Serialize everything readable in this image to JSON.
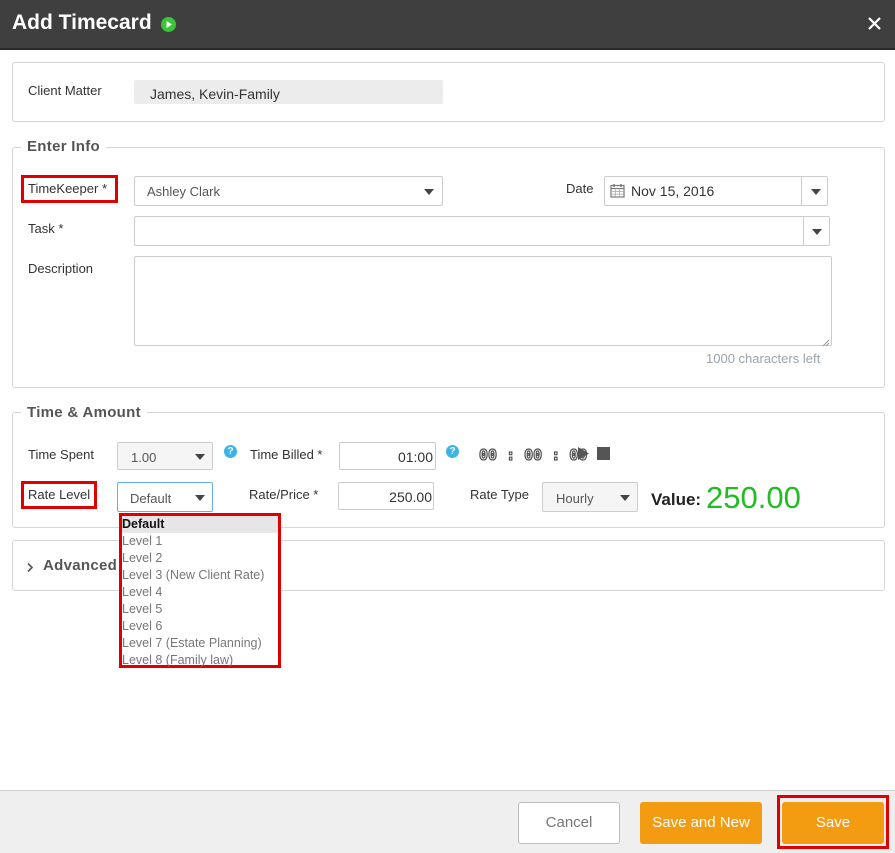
{
  "header": {
    "title": "Add Timecard"
  },
  "client_matter": {
    "label": "Client Matter",
    "value": "James, Kevin-Family"
  },
  "enter_info": {
    "legend": "Enter Info",
    "timekeeper_label": "TimeKeeper *",
    "timekeeper_value": "Ashley Clark",
    "date_label": "Date",
    "date_value": "Nov 15, 2016",
    "task_label": "Task *",
    "task_value": "",
    "description_label": "Description",
    "description_value": "",
    "chars_left": "1000 characters left"
  },
  "time_amount": {
    "legend": "Time & Amount",
    "time_spent_label": "Time Spent",
    "time_spent_value": "1.00",
    "time_billed_label": "Time Billed *",
    "time_billed_value": "01:00",
    "timer_value": "00 : 00 : 00",
    "rate_level_label": "Rate Level",
    "rate_level_value": "Default",
    "rate_price_label": "Rate/Price *",
    "rate_price_value": "250.00",
    "rate_type_label": "Rate Type",
    "rate_type_value": "Hourly",
    "value_label": "Value:",
    "value_amount": "250.00",
    "rate_level_options": [
      "Default",
      "Level 1",
      "Level 2",
      "Level 3 (New Client Rate)",
      "Level 4",
      "Level 5",
      "Level 6",
      "Level 7 (Estate Planning)",
      "Level 8 (Family law)"
    ]
  },
  "advanced": {
    "label": "Advanced"
  },
  "footer": {
    "cancel_label": "Cancel",
    "save_new_label": "Save and New",
    "save_label": "Save"
  },
  "colors": {
    "header_bg": "#3f3f3f",
    "accent_orange": "#f39c12",
    "value_green": "#22bb22",
    "highlight_red": "#e00000",
    "help_blue": "#3bb4e6"
  }
}
